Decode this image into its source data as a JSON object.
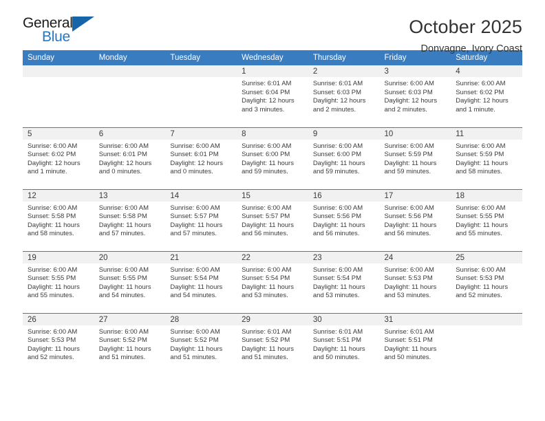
{
  "logo": {
    "word_top": "General",
    "word_bottom": "Blue",
    "triangle_color": "#1565a8",
    "blue_color": "#2277c8",
    "icon": "general-blue-logo"
  },
  "header": {
    "title": "October 2025",
    "subtitle": "Donvagne, Ivory Coast"
  },
  "colors": {
    "header_blue": "#3a7cc0",
    "daynum_gray": "#f1f1f1",
    "text": "#3a3a3a"
  },
  "labels": {
    "sunrise_prefix": "Sunrise:",
    "sunset_prefix": "Sunset:",
    "daylight_prefix": "Daylight:"
  },
  "weekdays": [
    "Sunday",
    "Monday",
    "Tuesday",
    "Wednesday",
    "Thursday",
    "Friday",
    "Saturday"
  ],
  "weeks": [
    [
      {
        "empty": true
      },
      {
        "empty": true
      },
      {
        "empty": true
      },
      {
        "day": "1",
        "sunrise": "Sunrise: 6:01 AM",
        "sunset": "Sunset: 6:04 PM",
        "daylight_1": "Daylight: 12 hours",
        "daylight_2": "and 3 minutes."
      },
      {
        "day": "2",
        "sunrise": "Sunrise: 6:01 AM",
        "sunset": "Sunset: 6:03 PM",
        "daylight_1": "Daylight: 12 hours",
        "daylight_2": "and 2 minutes."
      },
      {
        "day": "3",
        "sunrise": "Sunrise: 6:00 AM",
        "sunset": "Sunset: 6:03 PM",
        "daylight_1": "Daylight: 12 hours",
        "daylight_2": "and 2 minutes."
      },
      {
        "day": "4",
        "sunrise": "Sunrise: 6:00 AM",
        "sunset": "Sunset: 6:02 PM",
        "daylight_1": "Daylight: 12 hours",
        "daylight_2": "and 1 minute."
      }
    ],
    [
      {
        "day": "5",
        "sunrise": "Sunrise: 6:00 AM",
        "sunset": "Sunset: 6:02 PM",
        "daylight_1": "Daylight: 12 hours",
        "daylight_2": "and 1 minute."
      },
      {
        "day": "6",
        "sunrise": "Sunrise: 6:00 AM",
        "sunset": "Sunset: 6:01 PM",
        "daylight_1": "Daylight: 12 hours",
        "daylight_2": "and 0 minutes."
      },
      {
        "day": "7",
        "sunrise": "Sunrise: 6:00 AM",
        "sunset": "Sunset: 6:01 PM",
        "daylight_1": "Daylight: 12 hours",
        "daylight_2": "and 0 minutes."
      },
      {
        "day": "8",
        "sunrise": "Sunrise: 6:00 AM",
        "sunset": "Sunset: 6:00 PM",
        "daylight_1": "Daylight: 11 hours",
        "daylight_2": "and 59 minutes."
      },
      {
        "day": "9",
        "sunrise": "Sunrise: 6:00 AM",
        "sunset": "Sunset: 6:00 PM",
        "daylight_1": "Daylight: 11 hours",
        "daylight_2": "and 59 minutes."
      },
      {
        "day": "10",
        "sunrise": "Sunrise: 6:00 AM",
        "sunset": "Sunset: 5:59 PM",
        "daylight_1": "Daylight: 11 hours",
        "daylight_2": "and 59 minutes."
      },
      {
        "day": "11",
        "sunrise": "Sunrise: 6:00 AM",
        "sunset": "Sunset: 5:59 PM",
        "daylight_1": "Daylight: 11 hours",
        "daylight_2": "and 58 minutes."
      }
    ],
    [
      {
        "day": "12",
        "sunrise": "Sunrise: 6:00 AM",
        "sunset": "Sunset: 5:58 PM",
        "daylight_1": "Daylight: 11 hours",
        "daylight_2": "and 58 minutes."
      },
      {
        "day": "13",
        "sunrise": "Sunrise: 6:00 AM",
        "sunset": "Sunset: 5:58 PM",
        "daylight_1": "Daylight: 11 hours",
        "daylight_2": "and 57 minutes."
      },
      {
        "day": "14",
        "sunrise": "Sunrise: 6:00 AM",
        "sunset": "Sunset: 5:57 PM",
        "daylight_1": "Daylight: 11 hours",
        "daylight_2": "and 57 minutes."
      },
      {
        "day": "15",
        "sunrise": "Sunrise: 6:00 AM",
        "sunset": "Sunset: 5:57 PM",
        "daylight_1": "Daylight: 11 hours",
        "daylight_2": "and 56 minutes."
      },
      {
        "day": "16",
        "sunrise": "Sunrise: 6:00 AM",
        "sunset": "Sunset: 5:56 PM",
        "daylight_1": "Daylight: 11 hours",
        "daylight_2": "and 56 minutes."
      },
      {
        "day": "17",
        "sunrise": "Sunrise: 6:00 AM",
        "sunset": "Sunset: 5:56 PM",
        "daylight_1": "Daylight: 11 hours",
        "daylight_2": "and 56 minutes."
      },
      {
        "day": "18",
        "sunrise": "Sunrise: 6:00 AM",
        "sunset": "Sunset: 5:55 PM",
        "daylight_1": "Daylight: 11 hours",
        "daylight_2": "and 55 minutes."
      }
    ],
    [
      {
        "day": "19",
        "sunrise": "Sunrise: 6:00 AM",
        "sunset": "Sunset: 5:55 PM",
        "daylight_1": "Daylight: 11 hours",
        "daylight_2": "and 55 minutes."
      },
      {
        "day": "20",
        "sunrise": "Sunrise: 6:00 AM",
        "sunset": "Sunset: 5:55 PM",
        "daylight_1": "Daylight: 11 hours",
        "daylight_2": "and 54 minutes."
      },
      {
        "day": "21",
        "sunrise": "Sunrise: 6:00 AM",
        "sunset": "Sunset: 5:54 PM",
        "daylight_1": "Daylight: 11 hours",
        "daylight_2": "and 54 minutes."
      },
      {
        "day": "22",
        "sunrise": "Sunrise: 6:00 AM",
        "sunset": "Sunset: 5:54 PM",
        "daylight_1": "Daylight: 11 hours",
        "daylight_2": "and 53 minutes."
      },
      {
        "day": "23",
        "sunrise": "Sunrise: 6:00 AM",
        "sunset": "Sunset: 5:54 PM",
        "daylight_1": "Daylight: 11 hours",
        "daylight_2": "and 53 minutes."
      },
      {
        "day": "24",
        "sunrise": "Sunrise: 6:00 AM",
        "sunset": "Sunset: 5:53 PM",
        "daylight_1": "Daylight: 11 hours",
        "daylight_2": "and 53 minutes."
      },
      {
        "day": "25",
        "sunrise": "Sunrise: 6:00 AM",
        "sunset": "Sunset: 5:53 PM",
        "daylight_1": "Daylight: 11 hours",
        "daylight_2": "and 52 minutes."
      }
    ],
    [
      {
        "day": "26",
        "sunrise": "Sunrise: 6:00 AM",
        "sunset": "Sunset: 5:53 PM",
        "daylight_1": "Daylight: 11 hours",
        "daylight_2": "and 52 minutes."
      },
      {
        "day": "27",
        "sunrise": "Sunrise: 6:00 AM",
        "sunset": "Sunset: 5:52 PM",
        "daylight_1": "Daylight: 11 hours",
        "daylight_2": "and 51 minutes."
      },
      {
        "day": "28",
        "sunrise": "Sunrise: 6:00 AM",
        "sunset": "Sunset: 5:52 PM",
        "daylight_1": "Daylight: 11 hours",
        "daylight_2": "and 51 minutes."
      },
      {
        "day": "29",
        "sunrise": "Sunrise: 6:01 AM",
        "sunset": "Sunset: 5:52 PM",
        "daylight_1": "Daylight: 11 hours",
        "daylight_2": "and 51 minutes."
      },
      {
        "day": "30",
        "sunrise": "Sunrise: 6:01 AM",
        "sunset": "Sunset: 5:51 PM",
        "daylight_1": "Daylight: 11 hours",
        "daylight_2": "and 50 minutes."
      },
      {
        "day": "31",
        "sunrise": "Sunrise: 6:01 AM",
        "sunset": "Sunset: 5:51 PM",
        "daylight_1": "Daylight: 11 hours",
        "daylight_2": "and 50 minutes."
      },
      {
        "empty": true
      }
    ]
  ]
}
